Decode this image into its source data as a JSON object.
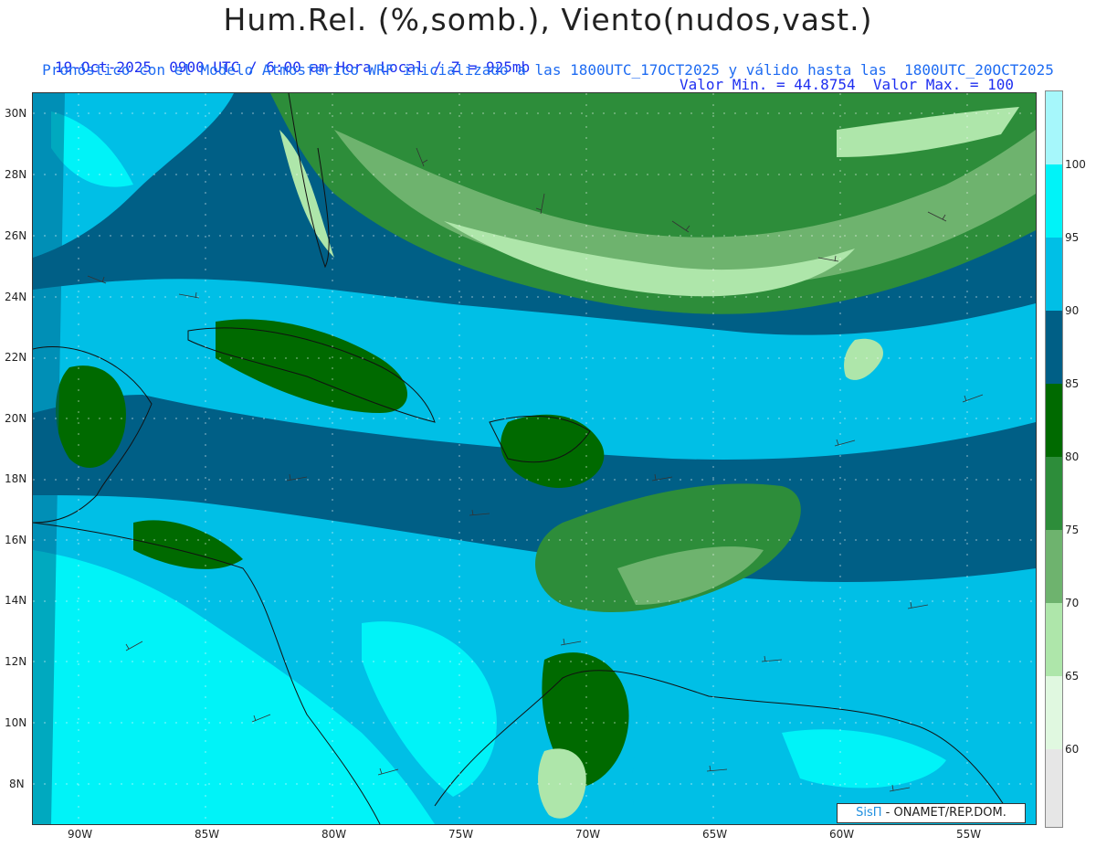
{
  "title": "Hum.Rel. (%,somb.), Viento(nudos,vast.)",
  "subtitle_left": "19-Oct-2025  0900 UTC / 6:00 am Hora Local / Z = 925mb",
  "subtitle_right": "Valor Min. = 44.8754  Valor Max. = 100",
  "subtitle2": "Pronóstico con el Modelo Atmosferico WRF inicializado a las 1800UTC_17OCT2025 y válido hasta las  1800UTC_20OCT2025",
  "lat_labels": [
    "30N",
    "28N",
    "26N",
    "24N",
    "22N",
    "20N",
    "18N",
    "16N",
    "14N",
    "12N",
    "10N",
    "8N"
  ],
  "lon_labels": [
    "90W",
    "85W",
    "80W",
    "75W",
    "70W",
    "65W",
    "60W",
    "55W"
  ],
  "colorbar": {
    "labels": [
      "100",
      "95",
      "90",
      "85",
      "80",
      "75",
      "70",
      "65",
      "60"
    ],
    "colors": [
      "#a6f7fb",
      "#00f3f8",
      "#00bfe6",
      "#005f86",
      "#006a00",
      "#2d8d3a",
      "#6eb36e",
      "#aee6aa",
      "#e0f8e0",
      "#e6e6e6"
    ]
  },
  "credit": {
    "brand": "SisΠ",
    "text": " - ONAMET/REP.DOM."
  },
  "value_min": 44.8754,
  "value_max": 100
}
